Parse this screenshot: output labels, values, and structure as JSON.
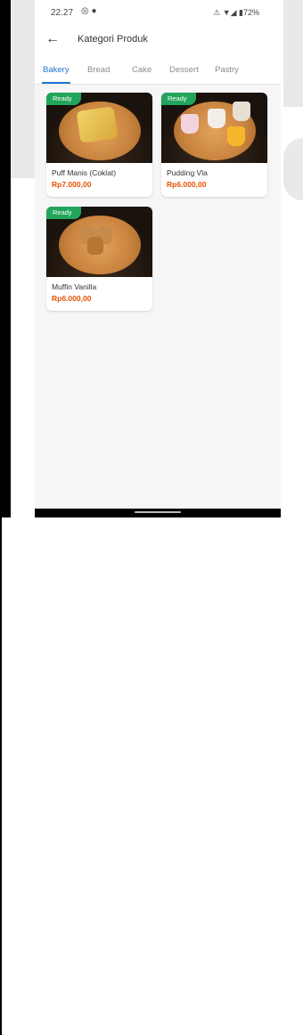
{
  "status_bar": {
    "time": "22.27",
    "left_icons": "◎ ●",
    "battery": "⚠ ▼◢ ▮72%"
  },
  "app_bar": {
    "back_icon": "←",
    "title": "Kategori Produk"
  },
  "tabs": [
    {
      "label": "Bakery",
      "active": true
    },
    {
      "label": "Bread",
      "active": false
    },
    {
      "label": "Cake",
      "active": false
    },
    {
      "label": "Dessert",
      "active": false
    },
    {
      "label": "Pastry",
      "active": false
    }
  ],
  "products": [
    {
      "badge": "Ready",
      "name": "Puff Manis (Coklat)",
      "price": "Rp7.000,00"
    },
    {
      "badge": "Ready",
      "name": "Pudding Vla",
      "price": "Rp6.000,00"
    },
    {
      "badge": "Ready",
      "name": "Muffin Vanilla",
      "price": "Rp6.000,00"
    }
  ],
  "colors": {
    "accent": "#1976d2",
    "badge": "#22a55a",
    "price": "#e65100"
  }
}
